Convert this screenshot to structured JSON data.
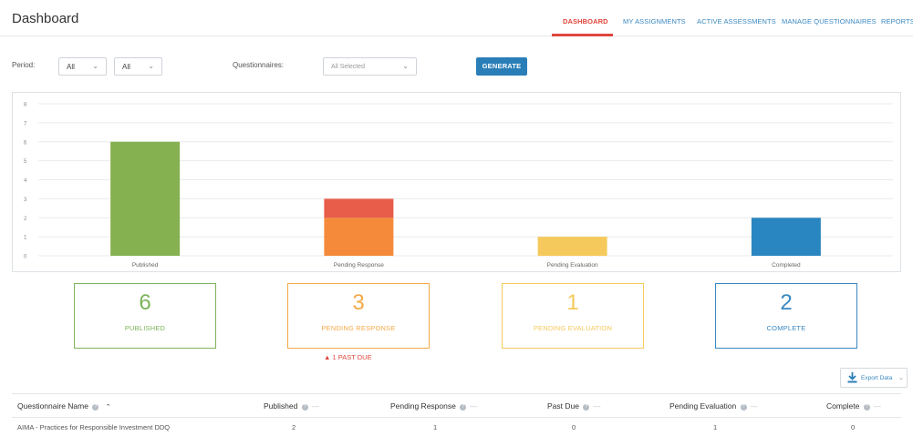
{
  "header": {
    "title": "Dashboard",
    "nav": [
      "DASHBOARD",
      "MY ASSIGNMENTS",
      "ACTIVE ASSESSMENTS",
      "MANAGE QUESTIONNAIRES",
      "REPORTS"
    ],
    "active_tab": "DASHBOARD",
    "accent_color": "#e0463c"
  },
  "filters": {
    "period_label": "Period:",
    "period_1": "All",
    "period_2": "All",
    "questionnaires_label": "Questionnaires:",
    "questionnaires_value": "All Selected",
    "generate_label": "GENERATE"
  },
  "chart_data": {
    "type": "bar",
    "stacked": true,
    "categories": [
      "Published",
      "Pending Response",
      "Pending Evaluation",
      "Completed"
    ],
    "ylim": [
      0,
      8
    ],
    "yticks": [
      "0",
      "1",
      "2",
      "3",
      "4",
      "5",
      "6",
      "7",
      "8"
    ],
    "grid": true,
    "series": [
      {
        "values": [
          6,
          2,
          1,
          2
        ],
        "colors": [
          "#86b150",
          "#f58a3a",
          "#f5c95b",
          "#2a86c0"
        ]
      },
      {
        "values": [
          0,
          1,
          0,
          0
        ],
        "colors": [
          "#e85c4a",
          "#e85c4a",
          "#e85c4a",
          "#e85c4a"
        ]
      }
    ]
  },
  "stats": [
    {
      "num": "6",
      "label": "PUBLISHED",
      "color": "#7cb35a"
    },
    {
      "num": "3",
      "label": "PENDING RESPONSE",
      "color": "#f5a948"
    },
    {
      "num": "1",
      "label": "PENDING EVALUATION",
      "color": "#f5c95b"
    },
    {
      "num": "2",
      "label": "COMPLETE",
      "color": "#3a88c0"
    }
  ],
  "past_due": "1 PAST DUE",
  "export_label": "Export Data",
  "table": {
    "columns": [
      "Questionnaire Name",
      "Published",
      "Pending Response",
      "Past Due",
      "Pending Evaluation",
      "Complete"
    ],
    "rows": [
      [
        "AIMA - Practices for Responsible Investment DDQ",
        "2",
        "1",
        "0",
        "1",
        "0"
      ]
    ]
  }
}
